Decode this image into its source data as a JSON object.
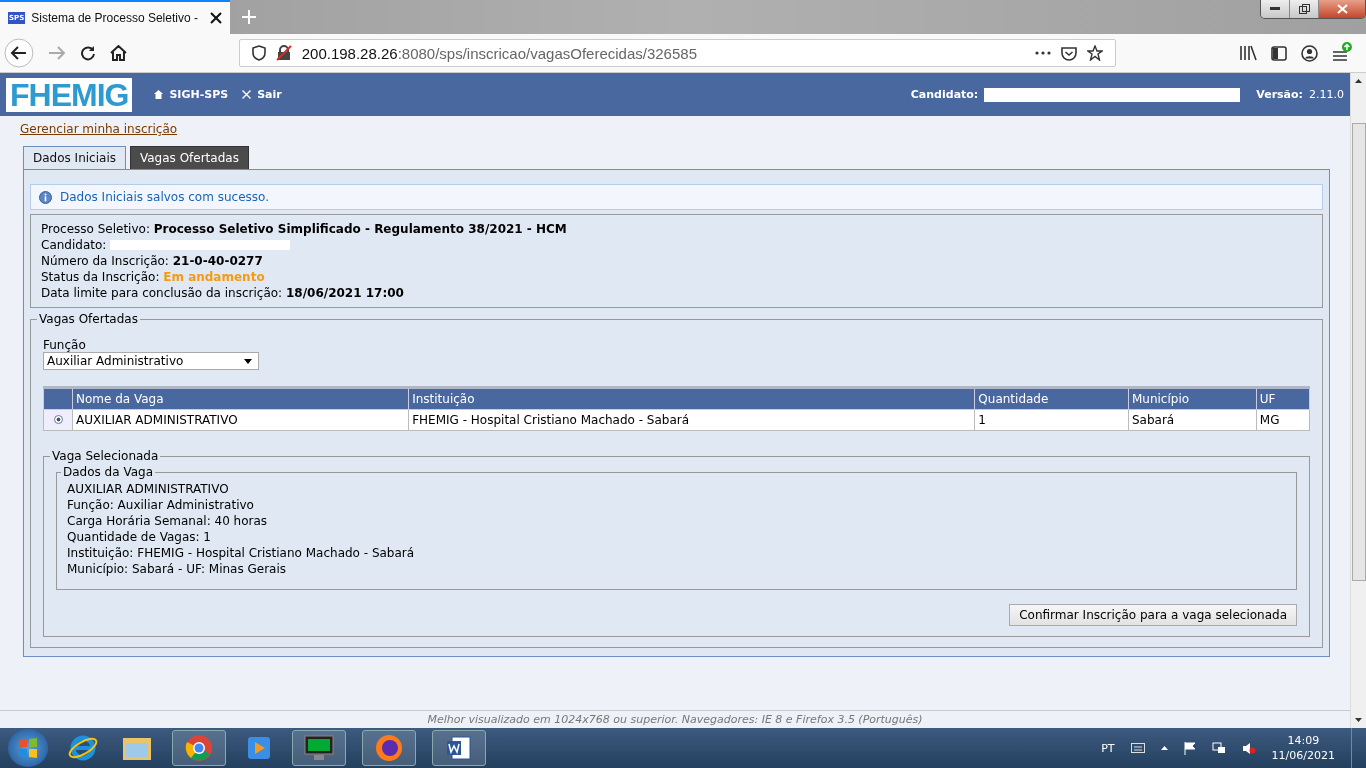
{
  "browser": {
    "tab": {
      "favicon": "SPS",
      "title": "Sistema de Processo Seletivo -"
    },
    "url_host": "200.198.28.26",
    "url_rest": ":8080/sps/inscricao/vagasOferecidas/326585"
  },
  "header": {
    "logo": "FHEMIG",
    "nav": [
      {
        "kind": "home",
        "label": "SIGH-SPS"
      },
      {
        "kind": "close",
        "label": "Sair"
      }
    ],
    "candidate_label": "Candidato:",
    "version_label": "Versão:",
    "version": "2.11.0"
  },
  "manage_link": "Gerenciar minha inscrição",
  "tabs": [
    {
      "label": "Dados Iniciais",
      "selected": false
    },
    {
      "label": "Vagas Ofertadas",
      "selected": true
    }
  ],
  "message": "Dados Iniciais salvos com sucesso.",
  "summary": [
    {
      "label": "Processo Seletivo:",
      "value": "Processo Seletivo Simplificado - Regulamento 38/2021 - HCM",
      "kind": "bold"
    },
    {
      "label": "Candidato:",
      "kind": "redacted"
    },
    {
      "label": "Número da Inscrição:",
      "value": "21-0-40-0277",
      "kind": "bold"
    },
    {
      "label": "Status da Inscrição:",
      "value": "Em andamento",
      "kind": "status"
    },
    {
      "label": "Data limite para conclusão da inscrição:",
      "value": "18/06/2021 17:00",
      "kind": "bold"
    }
  ],
  "vagas": {
    "legend": "Vagas Ofertadas",
    "funcao_label": "Função",
    "funcao_value": "Auxiliar Administrativo",
    "columns": [
      "Nome da Vaga",
      "Instituição",
      "Quantidade",
      "Município",
      "UF"
    ],
    "rows": [
      {
        "selected": true,
        "cells": [
          "AUXILIAR ADMINISTRATIVO",
          "FHEMIG - Hospital Cristiano Machado - Sabará",
          "1",
          "Sabará",
          "MG"
        ]
      }
    ]
  },
  "selected_vaga": {
    "legend": "Vaga Selecionada",
    "inner_legend": "Dados da Vaga",
    "lines": [
      "AUXILIAR ADMINISTRATIVO",
      "Função: Auxiliar Administrativo",
      "Carga Horária Semanal: 40 horas",
      "Quantidade de Vagas: 1",
      "Instituição: FHEMIG - Hospital Cristiano Machado - Sabará",
      "Município: Sabará - UF: Minas Gerais"
    ],
    "button": "Confirmar Inscrição para a vaga selecionada"
  },
  "footer": "Melhor visualizado em 1024x768 ou superior. Navegadores: IE 8 e Firefox 3.5 (Português)",
  "taskbar": {
    "language": "PT",
    "time": "14:09",
    "date": "11/06/2021"
  }
}
